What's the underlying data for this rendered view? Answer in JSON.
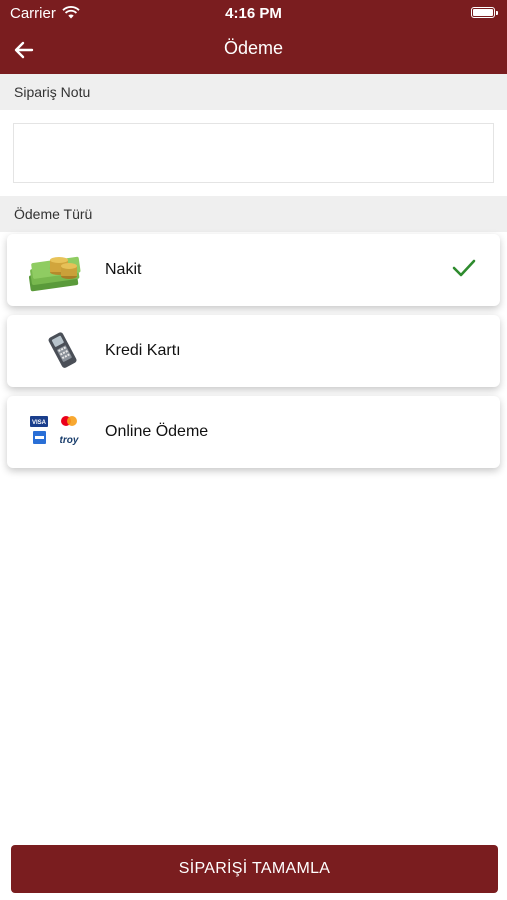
{
  "status_bar": {
    "carrier": "Carrier",
    "time": "4:16 PM"
  },
  "header": {
    "title": "Ödeme"
  },
  "order_note": {
    "section_label": "Sipariş Notu",
    "value": "",
    "placeholder": ""
  },
  "payment": {
    "section_label": "Ödeme Türü",
    "options": [
      {
        "label": "Nakit",
        "icon": "cash-icon",
        "selected": true
      },
      {
        "label": "Kredi Kartı",
        "icon": "card-terminal-icon",
        "selected": false
      },
      {
        "label": "Online Ödeme",
        "icon": "card-brands-icon",
        "selected": false
      }
    ],
    "brand_text": {
      "visa": "VISA",
      "troy": "troy"
    }
  },
  "actions": {
    "complete_label": "SİPARİŞİ TAMAMLA"
  },
  "colors": {
    "brand": "#7a1d1f",
    "section_bg": "#efefef",
    "check": "#2e8b2e"
  }
}
